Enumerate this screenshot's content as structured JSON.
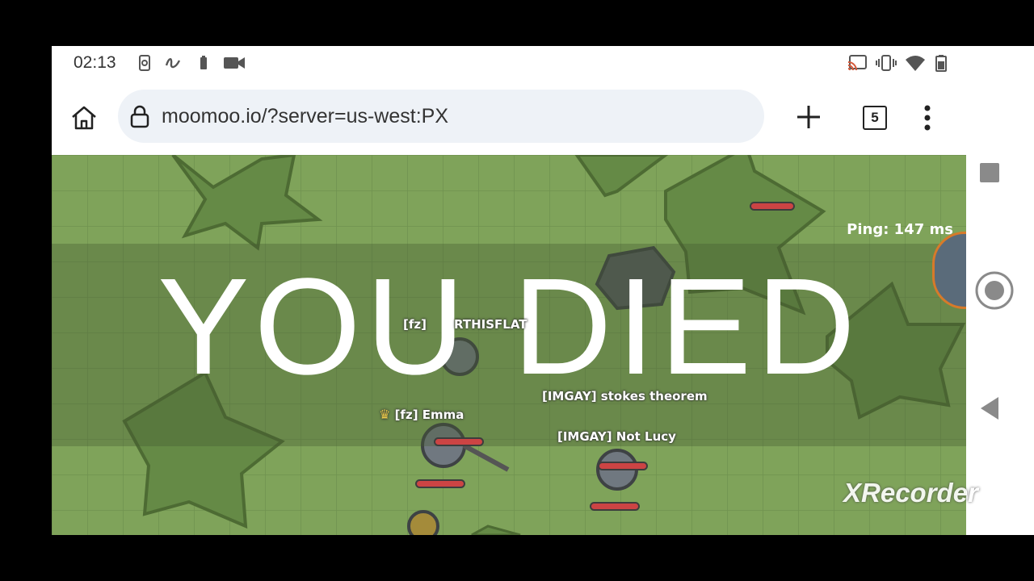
{
  "status_bar": {
    "time": "02:13",
    "left_icons": [
      "screenshot-icon",
      "squiggle-icon",
      "battery-saver-icon",
      "video-record-icon"
    ],
    "right_icons": [
      "cast-icon",
      "vibrate-icon",
      "wifi-icon",
      "battery-icon"
    ]
  },
  "browser": {
    "url": "moomoo.io/?server=us-west:PX",
    "tab_count": "5"
  },
  "game": {
    "banner": "YOU DIED",
    "ping": "Ping: 147 ms",
    "players": [
      {
        "name": "[fz]",
        "extra": "RTHISFLAT"
      },
      {
        "name": "[fz] Emma"
      },
      {
        "name": "[IMGAY] stokes theorem"
      },
      {
        "name": "[IMGAY] Not Lucy"
      }
    ]
  },
  "watermark": "XRecorder",
  "colors": {
    "grass": "#7fa35a",
    "bush": "#5d7f3e",
    "health": "#c44444"
  }
}
